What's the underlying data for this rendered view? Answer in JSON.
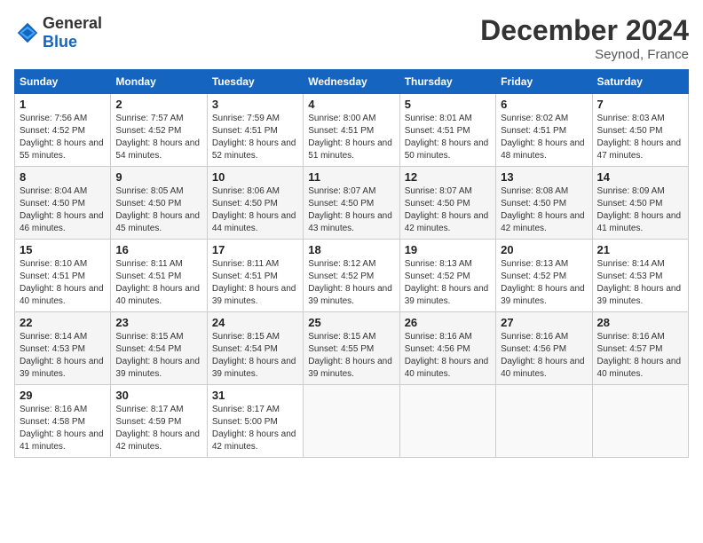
{
  "header": {
    "logo_general": "General",
    "logo_blue": "Blue",
    "month": "December 2024",
    "location": "Seynod, France"
  },
  "weekdays": [
    "Sunday",
    "Monday",
    "Tuesday",
    "Wednesday",
    "Thursday",
    "Friday",
    "Saturday"
  ],
  "weeks": [
    [
      {
        "day": "1",
        "sunrise": "7:56 AM",
        "sunset": "4:52 PM",
        "daylight": "8 hours and 55 minutes."
      },
      {
        "day": "2",
        "sunrise": "7:57 AM",
        "sunset": "4:52 PM",
        "daylight": "8 hours and 54 minutes."
      },
      {
        "day": "3",
        "sunrise": "7:59 AM",
        "sunset": "4:51 PM",
        "daylight": "8 hours and 52 minutes."
      },
      {
        "day": "4",
        "sunrise": "8:00 AM",
        "sunset": "4:51 PM",
        "daylight": "8 hours and 51 minutes."
      },
      {
        "day": "5",
        "sunrise": "8:01 AM",
        "sunset": "4:51 PM",
        "daylight": "8 hours and 50 minutes."
      },
      {
        "day": "6",
        "sunrise": "8:02 AM",
        "sunset": "4:51 PM",
        "daylight": "8 hours and 48 minutes."
      },
      {
        "day": "7",
        "sunrise": "8:03 AM",
        "sunset": "4:50 PM",
        "daylight": "8 hours and 47 minutes."
      }
    ],
    [
      {
        "day": "8",
        "sunrise": "8:04 AM",
        "sunset": "4:50 PM",
        "daylight": "8 hours and 46 minutes."
      },
      {
        "day": "9",
        "sunrise": "8:05 AM",
        "sunset": "4:50 PM",
        "daylight": "8 hours and 45 minutes."
      },
      {
        "day": "10",
        "sunrise": "8:06 AM",
        "sunset": "4:50 PM",
        "daylight": "8 hours and 44 minutes."
      },
      {
        "day": "11",
        "sunrise": "8:07 AM",
        "sunset": "4:50 PM",
        "daylight": "8 hours and 43 minutes."
      },
      {
        "day": "12",
        "sunrise": "8:07 AM",
        "sunset": "4:50 PM",
        "daylight": "8 hours and 42 minutes."
      },
      {
        "day": "13",
        "sunrise": "8:08 AM",
        "sunset": "4:50 PM",
        "daylight": "8 hours and 42 minutes."
      },
      {
        "day": "14",
        "sunrise": "8:09 AM",
        "sunset": "4:50 PM",
        "daylight": "8 hours and 41 minutes."
      }
    ],
    [
      {
        "day": "15",
        "sunrise": "8:10 AM",
        "sunset": "4:51 PM",
        "daylight": "8 hours and 40 minutes."
      },
      {
        "day": "16",
        "sunrise": "8:11 AM",
        "sunset": "4:51 PM",
        "daylight": "8 hours and 40 minutes."
      },
      {
        "day": "17",
        "sunrise": "8:11 AM",
        "sunset": "4:51 PM",
        "daylight": "8 hours and 39 minutes."
      },
      {
        "day": "18",
        "sunrise": "8:12 AM",
        "sunset": "4:52 PM",
        "daylight": "8 hours and 39 minutes."
      },
      {
        "day": "19",
        "sunrise": "8:13 AM",
        "sunset": "4:52 PM",
        "daylight": "8 hours and 39 minutes."
      },
      {
        "day": "20",
        "sunrise": "8:13 AM",
        "sunset": "4:52 PM",
        "daylight": "8 hours and 39 minutes."
      },
      {
        "day": "21",
        "sunrise": "8:14 AM",
        "sunset": "4:53 PM",
        "daylight": "8 hours and 39 minutes."
      }
    ],
    [
      {
        "day": "22",
        "sunrise": "8:14 AM",
        "sunset": "4:53 PM",
        "daylight": "8 hours and 39 minutes."
      },
      {
        "day": "23",
        "sunrise": "8:15 AM",
        "sunset": "4:54 PM",
        "daylight": "8 hours and 39 minutes."
      },
      {
        "day": "24",
        "sunrise": "8:15 AM",
        "sunset": "4:54 PM",
        "daylight": "8 hours and 39 minutes."
      },
      {
        "day": "25",
        "sunrise": "8:15 AM",
        "sunset": "4:55 PM",
        "daylight": "8 hours and 39 minutes."
      },
      {
        "day": "26",
        "sunrise": "8:16 AM",
        "sunset": "4:56 PM",
        "daylight": "8 hours and 40 minutes."
      },
      {
        "day": "27",
        "sunrise": "8:16 AM",
        "sunset": "4:56 PM",
        "daylight": "8 hours and 40 minutes."
      },
      {
        "day": "28",
        "sunrise": "8:16 AM",
        "sunset": "4:57 PM",
        "daylight": "8 hours and 40 minutes."
      }
    ],
    [
      {
        "day": "29",
        "sunrise": "8:16 AM",
        "sunset": "4:58 PM",
        "daylight": "8 hours and 41 minutes."
      },
      {
        "day": "30",
        "sunrise": "8:17 AM",
        "sunset": "4:59 PM",
        "daylight": "8 hours and 42 minutes."
      },
      {
        "day": "31",
        "sunrise": "8:17 AM",
        "sunset": "5:00 PM",
        "daylight": "8 hours and 42 minutes."
      },
      null,
      null,
      null,
      null
    ]
  ]
}
